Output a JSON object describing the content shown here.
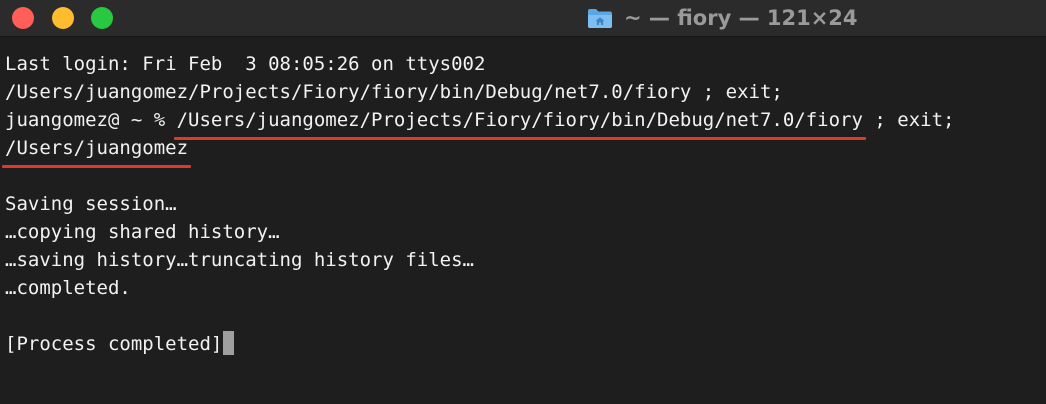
{
  "window": {
    "title": "~ — fiory — 121×24",
    "title_icon": "home-folder-icon",
    "traffic_lights": {
      "close_color": "#ff5f57",
      "minimize_color": "#febc2e",
      "zoom_color": "#28c840"
    }
  },
  "terminal": {
    "last_login": "Last login: Fri Feb  3 08:05:26 on ttys002",
    "command_line_1": "/Users/juangomez/Projects/Fiory/fiory/bin/Debug/net7.0/fiory ; exit;",
    "prompt": "juangomez@ ~ % ",
    "prompt_command_path": "/Users/juangomez/Projects/Fiory/fiory/bin/Debug/net7.0/fiory",
    "prompt_command_suffix": " ; exit;",
    "output_path": "/Users/juangomez",
    "saving_session": "Saving session…",
    "copying_history": "…copying shared history…",
    "saving_history": "…saving history…truncating history files…",
    "completed": "…completed.",
    "process_completed": "[Process completed]"
  },
  "colors": {
    "background": "#1e1e1e",
    "text": "#f2f2f2",
    "underline_annotation": "#e0382a",
    "cursor": "#9f9f9f"
  }
}
